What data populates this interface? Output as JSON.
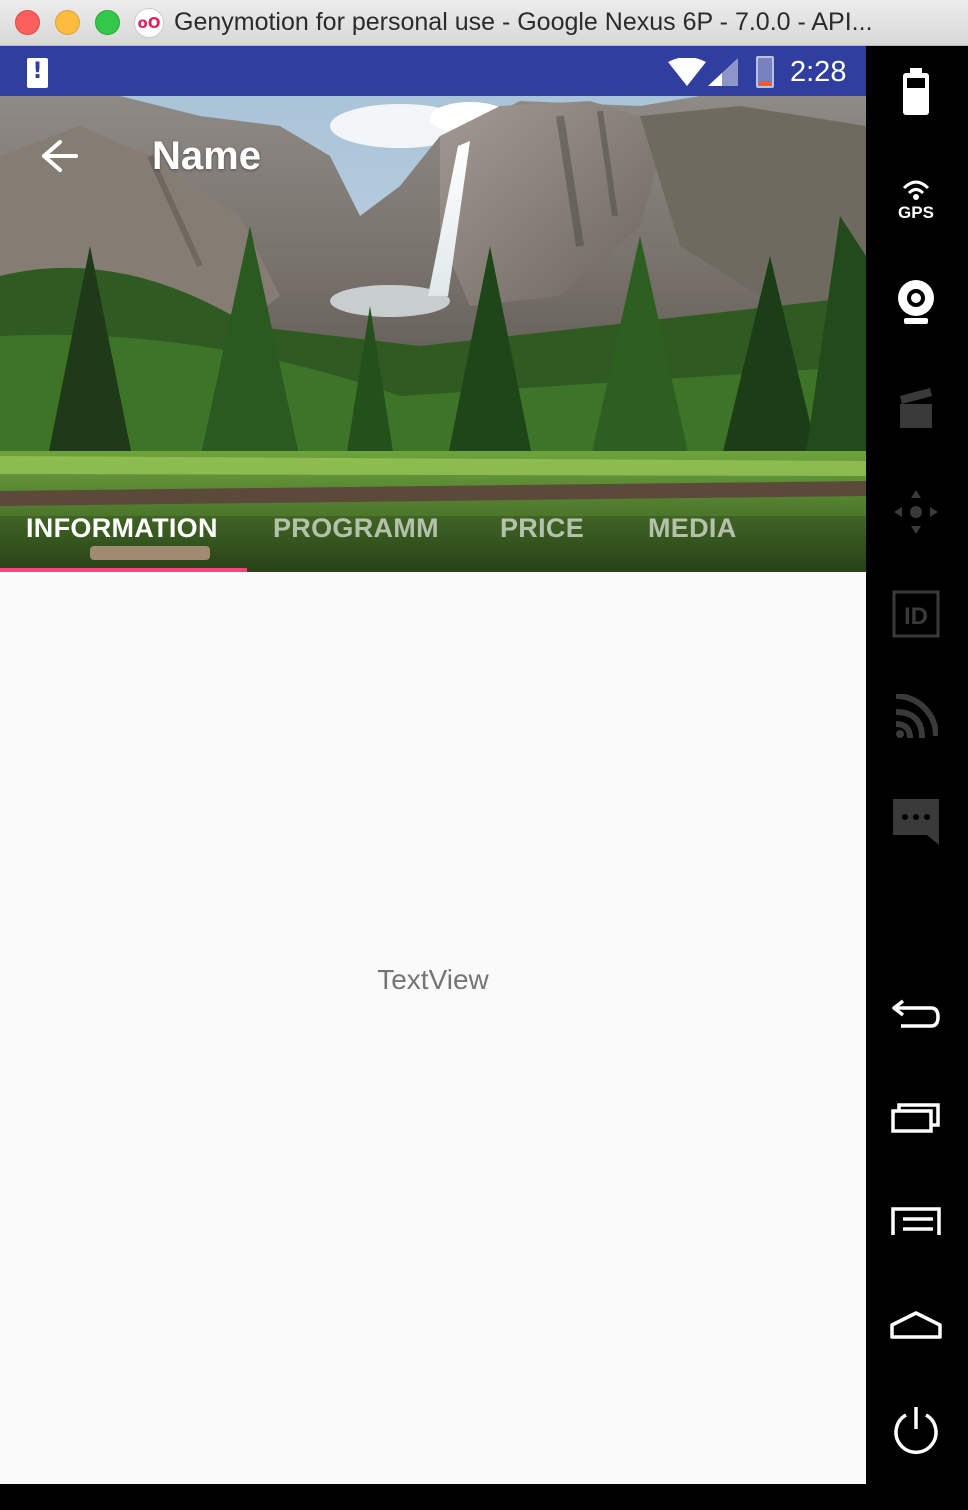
{
  "window": {
    "title": "Genymotion for personal use - Google Nexus 6P - 7.0.0 - API...",
    "app_icon_text": "oO"
  },
  "statusbar": {
    "time": "2:28"
  },
  "toolbar": {
    "title": "Name"
  },
  "tabs": [
    {
      "label": "INFORMATION",
      "active": true
    },
    {
      "label": "PROGRAMM",
      "active": false
    },
    {
      "label": "PRICE",
      "active": false
    },
    {
      "label": "MEDIA",
      "active": false
    }
  ],
  "content": {
    "text": "TextView"
  },
  "colors": {
    "statusbar": "#303f9f",
    "tab_indicator": "#ff4081",
    "background": "#fafafa"
  },
  "sidepanel": {
    "items": [
      {
        "icon": "battery-icon"
      },
      {
        "icon": "gps-icon",
        "label": "GPS"
      },
      {
        "icon": "camera-icon"
      },
      {
        "icon": "video-capture-icon"
      },
      {
        "icon": "dpad-icon"
      },
      {
        "icon": "device-id-icon",
        "label": "ID"
      },
      {
        "icon": "cast-icon"
      },
      {
        "icon": "sms-icon"
      },
      {
        "icon": "back-icon"
      },
      {
        "icon": "recent-apps-icon"
      },
      {
        "icon": "menu-icon"
      },
      {
        "icon": "home-icon"
      },
      {
        "icon": "power-icon"
      }
    ]
  }
}
